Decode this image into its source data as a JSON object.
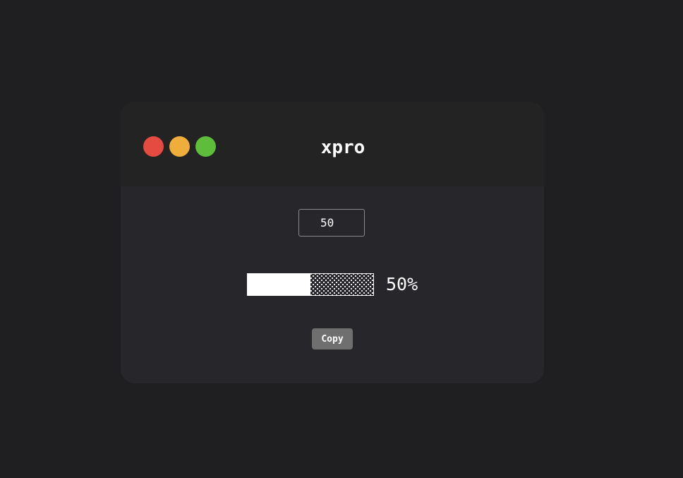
{
  "window": {
    "title": "xpro",
    "controls": {
      "close_color": "#e54b40",
      "minimize_color": "#efae3b",
      "maximize_color": "#5fbd3c"
    }
  },
  "form": {
    "input_value": "50"
  },
  "progress": {
    "value": 50,
    "label": "50%"
  },
  "actions": {
    "copy_label": "Copy"
  }
}
